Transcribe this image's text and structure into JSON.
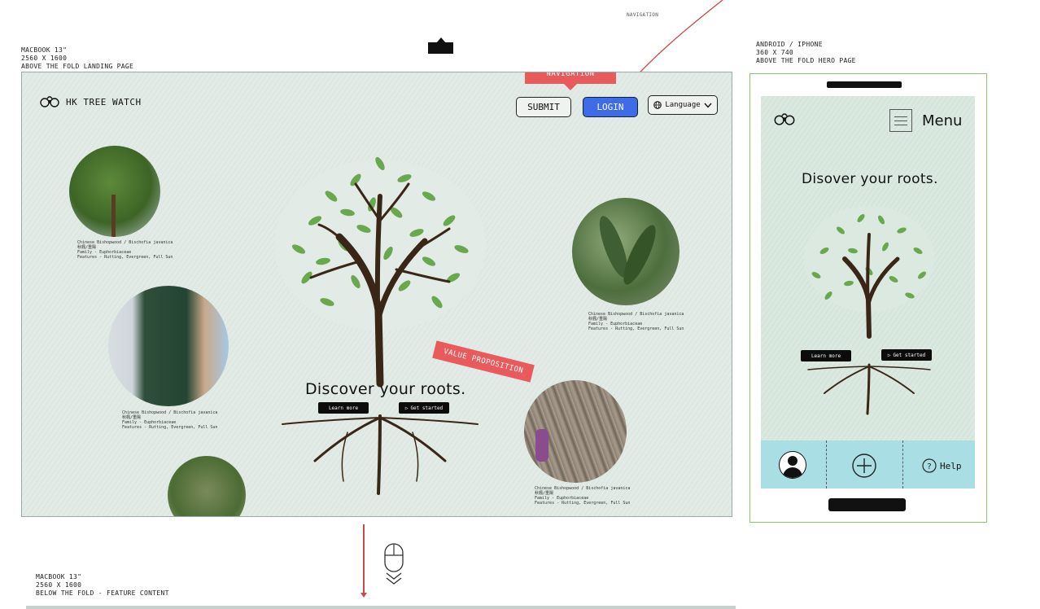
{
  "annotations": {
    "top_navigation_note": "NAVIGATION",
    "desktop_header": [
      "MACBOOK 13\"",
      "2560 X 1600",
      "ABOVE THE FOLD LANDING PAGE"
    ],
    "mobile_header": [
      "ANDROID / IPHONE",
      "360 X 740",
      "ABOVE THE FOLD HERO PAGE"
    ],
    "below_fold_header": [
      "MACBOOK 13\"",
      "2560 X 1600",
      "BELOW THE FOLD - FEATURE CONTENT"
    ],
    "navigation_callout": "NAVIGATION",
    "value_prop_callout": "VALUE PROPOSITION"
  },
  "desktop": {
    "brand": "HK TREE WATCH",
    "nav": {
      "submit": "SUBMIT",
      "login": "LOGIN",
      "language": "Language"
    },
    "hero": {
      "title": "Discover your roots.",
      "learn_more": "Learn more",
      "get_started": "Get started"
    },
    "trees": [
      {
        "name": "Chinese Bishopwood / Bischofia javanica",
        "cn": "秋楓/重陽",
        "family": "Family - Euphorbiaceae",
        "features": "Features - Rutting, Evergreen, Full Sun"
      },
      {
        "name": "Chinese Bishopwood / Bischofia javanica",
        "cn": "秋楓/重陽",
        "family": "Family - Euphorbiaceae",
        "features": "Features - Rutting, Evergreen, Full Sun"
      },
      {
        "name": "Chinese Bishopwood / Bischofia javanica",
        "cn": "秋楓/重陽",
        "family": "Family - Euphorbiaceae",
        "features": "Features - Rutting, Evergreen, Full Sun"
      },
      {
        "name": "Chinese Bishopwood / Bischofia javanica",
        "cn": "秋楓/重陽",
        "family": "Family - Euphorbiaceae",
        "features": "Features - Rutting, Evergreen, Full Sun"
      }
    ]
  },
  "mobile": {
    "menu": "Menu",
    "title": "Disover your roots.",
    "learn_more": "Learn more",
    "get_started": "Get started",
    "help": "Help"
  },
  "colors": {
    "accent_red": "#e85a5c",
    "login_blue": "#3e6be8",
    "mobile_bar": "#a9dfe4",
    "frame_green": "#8fc46a"
  }
}
